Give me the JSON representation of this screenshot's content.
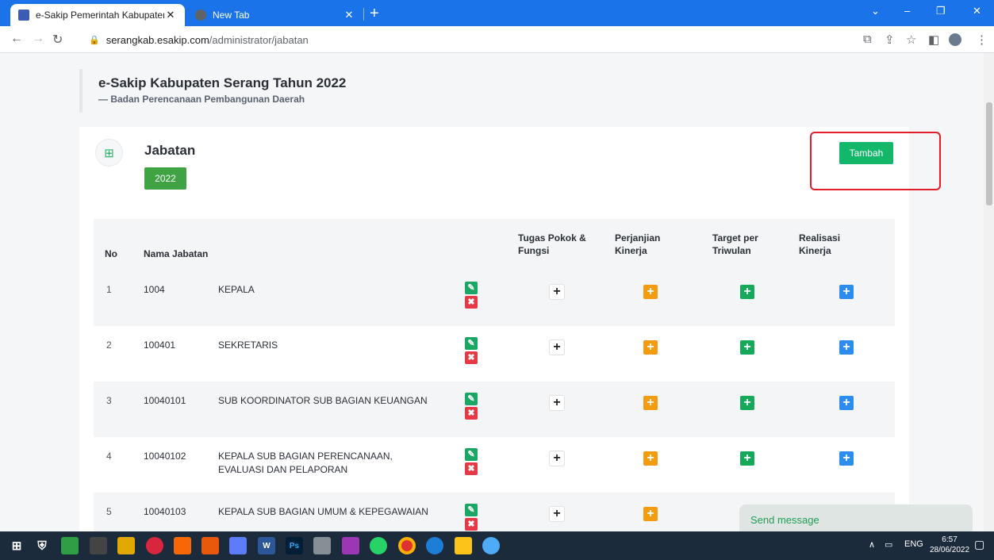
{
  "browser": {
    "tabs": [
      {
        "title": "e-Sakip Pemerintah Kabupaten S",
        "close": "✕"
      },
      {
        "title": "New Tab",
        "close": "✕"
      }
    ],
    "new_tab": "+",
    "url_host": "serangkab.esakip.com",
    "url_path": "/administrator/jabatan",
    "win_controls": {
      "collapse": "⌄",
      "minimize": "–",
      "maximize": "❐",
      "close": "✕"
    }
  },
  "page": {
    "site_title": "e-Sakip Kabupaten Serang Tahun 2022",
    "site_subtitle": "— Badan Perencanaan Pembangunan Daerah",
    "section_title": "Jabatan",
    "year": "2022",
    "add_button": "Tambah"
  },
  "table": {
    "headers": {
      "no": "No",
      "nama": "Nama Jabatan",
      "tupoksi_1": "Tugas Pokok &",
      "tupoksi_2": "Fungsi",
      "pk_1": "Perjanjian",
      "pk_2": "Kinerja",
      "target_1": "Target per",
      "target_2": "Triwulan",
      "realisasi_1": "Realisasi",
      "realisasi_2": "Kinerja"
    },
    "rows": [
      {
        "no": "1",
        "kode": "1004",
        "nama": "KEPALA",
        "nama2": ""
      },
      {
        "no": "2",
        "kode": "100401",
        "nama": "SEKRETARIS",
        "nama2": ""
      },
      {
        "no": "3",
        "kode": "10040101",
        "nama": "SUB KOORDINATOR SUB BAGIAN KEUANGAN",
        "nama2": ""
      },
      {
        "no": "4",
        "kode": "10040102",
        "nama": "KEPALA SUB BAGIAN PERENCANAAN,",
        "nama2": "EVALUASI DAN PELAPORAN"
      },
      {
        "no": "5",
        "kode": "10040103",
        "nama": "KEPALA SUB BAGIAN UMUM & KEPEGAWAIAN",
        "nama2": ""
      }
    ],
    "plus_glyph": "+",
    "edit_glyph": "✎",
    "delete_glyph": "✖"
  },
  "chat": {
    "label": "Send message"
  },
  "taskbar": {
    "lang": "ENG",
    "time": "6:57",
    "date": "28/06/2022",
    "ps_label": "Ps",
    "word_label": "W"
  },
  "colors": {
    "accent": "#12b76a",
    "highlight": "#e11d2a",
    "orange": "#f39c12",
    "blue": "#2d8cf0",
    "green": "#16a95c"
  }
}
